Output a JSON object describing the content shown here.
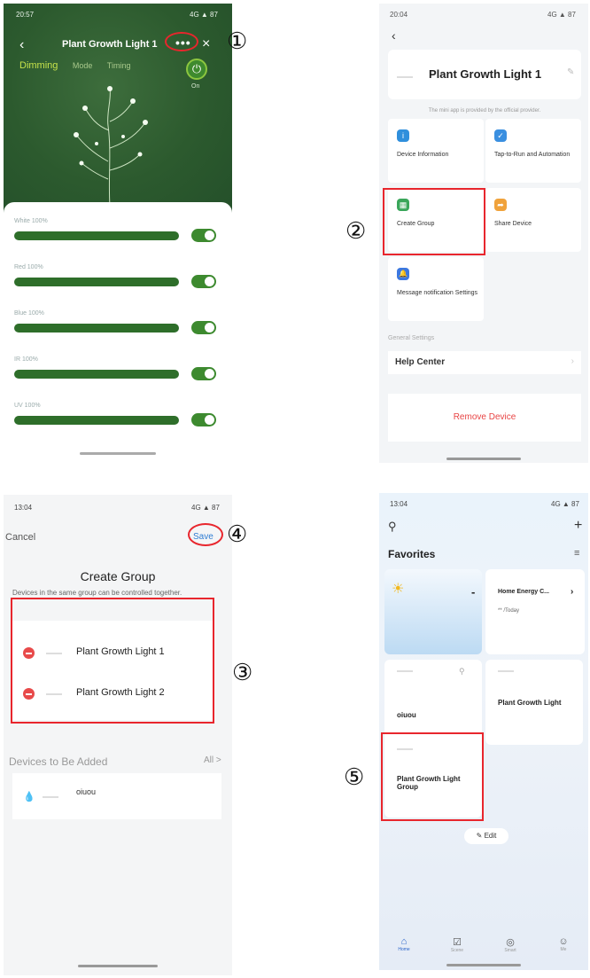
{
  "panel1": {
    "status_time": "20:57",
    "status_icons": "4G ▲ 87",
    "title": "Plant Growth Light 1",
    "more_icon": "•••",
    "modes": {
      "active": "Dimming",
      "mode2": "Mode",
      "mode3": "Timing"
    },
    "power_label": "On",
    "sliders": [
      {
        "label": "White 100%",
        "value": 1.0
      },
      {
        "label": "Red 100%",
        "value": 1.0
      },
      {
        "label": "Blue 100%",
        "value": 1.0
      },
      {
        "label": "IR 100%",
        "value": 1.0
      },
      {
        "label": "UV 100%",
        "value": 1.0
      }
    ]
  },
  "panel2": {
    "status_time": "20:04",
    "status_icons": "4G ▲ 87",
    "device_title": "Plant Growth Light 1",
    "notice": "The mini app is provided by the official provider.",
    "tiles": [
      {
        "label": "Device Information",
        "color": "#2f8fdc",
        "icon": "i"
      },
      {
        "label": "Tap-to-Run and Automation",
        "color": "#3a8fe0",
        "icon": "✓"
      },
      {
        "label": "Create Group",
        "color": "#3aa65a",
        "icon": "▦"
      },
      {
        "label": "Share Device",
        "color": "#f0a23b",
        "icon": "➦"
      },
      {
        "label": "Message notification Settings",
        "color": "#3c78e0",
        "icon": "🔔"
      }
    ],
    "section": "General Settings",
    "help": "Help Center",
    "remove": "Remove Device"
  },
  "panel3": {
    "status_time": "13:04",
    "status_icons": "4G ▲ 87",
    "cancel": "Cancel",
    "save": "Save",
    "title": "Create Group",
    "description": "Devices in the same group can be controlled together.",
    "members": [
      "Plant Growth Light 1",
      "Plant Growth Light 2"
    ],
    "to_add_label": "Devices to Be Added",
    "all_label": "All >",
    "to_add": [
      "oiuou"
    ]
  },
  "panel4": {
    "status_time": "13:04",
    "status_icons": "4G ▲ 87",
    "favorites": "Favorites",
    "weather_value": "-",
    "energy_title": "Home Energy C...",
    "energy_sub": "** /Today",
    "devices": [
      "oiuou",
      "Plant Growth Light",
      "Plant Growth Light Group"
    ],
    "edit": "Edit",
    "tabs": [
      {
        "label": "Home",
        "icon": "⌂"
      },
      {
        "label": "Scene",
        "icon": "☑"
      },
      {
        "label": "Smart",
        "icon": "◎"
      },
      {
        "label": "Me",
        "icon": "☺"
      }
    ]
  },
  "callouts": [
    "①",
    "②",
    "③",
    "④",
    "⑤"
  ],
  "colors": {
    "highlight": "#e8262d",
    "plant_green": "#2e6e2a",
    "accent_blue": "#2f7dd3"
  }
}
